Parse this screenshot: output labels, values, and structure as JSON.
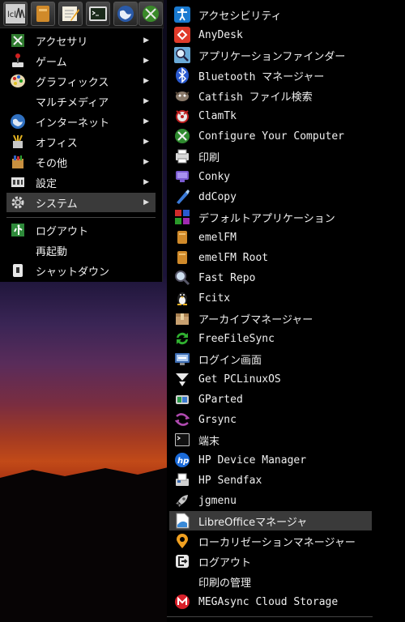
{
  "launcher": {
    "buttons": [
      {
        "icon": "pclinuxos-logo-icon"
      },
      {
        "icon": "file-manager-icon"
      },
      {
        "icon": "text-editor-icon"
      },
      {
        "icon": "terminal-icon"
      },
      {
        "icon": "web-browser-icon"
      },
      {
        "icon": "configure-computer-icon"
      }
    ]
  },
  "main_menu": {
    "items": [
      {
        "label": "アクセサリ",
        "icon": "accessories-icon",
        "submenu": true
      },
      {
        "label": "ゲーム",
        "icon": "games-icon",
        "submenu": true
      },
      {
        "label": "グラフィックス",
        "icon": "graphics-icon",
        "submenu": true
      },
      {
        "label": "マルチメディア",
        "icon": "",
        "submenu": true
      },
      {
        "label": "インターネット",
        "icon": "internet-icon",
        "submenu": true
      },
      {
        "label": "オフィス",
        "icon": "office-icon",
        "submenu": true
      },
      {
        "label": "その他",
        "icon": "other-icon",
        "submenu": true
      },
      {
        "label": "設定",
        "icon": "settings-icon",
        "submenu": true
      },
      {
        "label": "システム",
        "icon": "system-gear-icon",
        "submenu": true,
        "selected": true
      },
      {
        "label": "ログアウト",
        "icon": "logout-icon",
        "submenu": false
      },
      {
        "label": "再起動",
        "icon": "",
        "submenu": false
      },
      {
        "label": "シャットダウン",
        "icon": "shutdown-icon",
        "submenu": false
      }
    ],
    "arrow_glyph": "▶"
  },
  "system_submenu": {
    "items": [
      {
        "label": "アクセシビリティ",
        "icon": "accessibility-icon"
      },
      {
        "label": "AnyDesk",
        "icon": "anydesk-icon"
      },
      {
        "label": "アプリケーションファインダー",
        "icon": "app-finder-icon"
      },
      {
        "label": "Bluetooth マネージャー",
        "icon": "bluetooth-icon"
      },
      {
        "label": "Catfish ファイル検索",
        "icon": "catfish-icon"
      },
      {
        "label": "ClamTk",
        "icon": "clamtk-icon"
      },
      {
        "label": "Configure Your Computer",
        "icon": "configure-computer-icon"
      },
      {
        "label": "印刷",
        "icon": "printer-icon"
      },
      {
        "label": "Conky",
        "icon": "conky-icon"
      },
      {
        "label": "ddCopy",
        "icon": "ddcopy-icon"
      },
      {
        "label": "デフォルトアプリケーション",
        "icon": "default-apps-icon"
      },
      {
        "label": "emelFM",
        "icon": "emelfm-icon"
      },
      {
        "label": "emelFM Root",
        "icon": "emelfm-root-icon"
      },
      {
        "label": "Fast Repo",
        "icon": "fast-repo-icon"
      },
      {
        "label": "Fcitx",
        "icon": "fcitx-penguin-icon"
      },
      {
        "label": "アーカイブマネージャー",
        "icon": "archive-manager-icon"
      },
      {
        "label": "FreeFileSync",
        "icon": "freefilesync-icon"
      },
      {
        "label": "ログイン画面",
        "icon": "login-screen-icon"
      },
      {
        "label": "Get PCLinuxOS",
        "icon": "get-pclinuxos-icon"
      },
      {
        "label": "GParted",
        "icon": "gparted-icon"
      },
      {
        "label": "Grsync",
        "icon": "grsync-icon"
      },
      {
        "label": "端末",
        "icon": "terminal-icon"
      },
      {
        "label": "HP Device Manager",
        "icon": "hp-logo-icon"
      },
      {
        "label": "HP Sendfax",
        "icon": "fax-icon"
      },
      {
        "label": "jgmenu",
        "icon": "jgmenu-rocket-icon"
      },
      {
        "label": "LibreOfficeマネージャ",
        "icon": "libreoffice-icon",
        "selected": true
      },
      {
        "label": "ローカリゼーションマネージャー",
        "icon": "location-pin-icon"
      },
      {
        "label": "ログアウト",
        "icon": "logout-icon"
      },
      {
        "label": "印刷の管理",
        "icon": ""
      },
      {
        "label": "MEGAsync Cloud Storage",
        "icon": "mega-icon"
      }
    ]
  },
  "colors": {
    "menu_bg": "#000000",
    "selected_bg": "#3a3a3a",
    "text": "#f0f0f0"
  }
}
